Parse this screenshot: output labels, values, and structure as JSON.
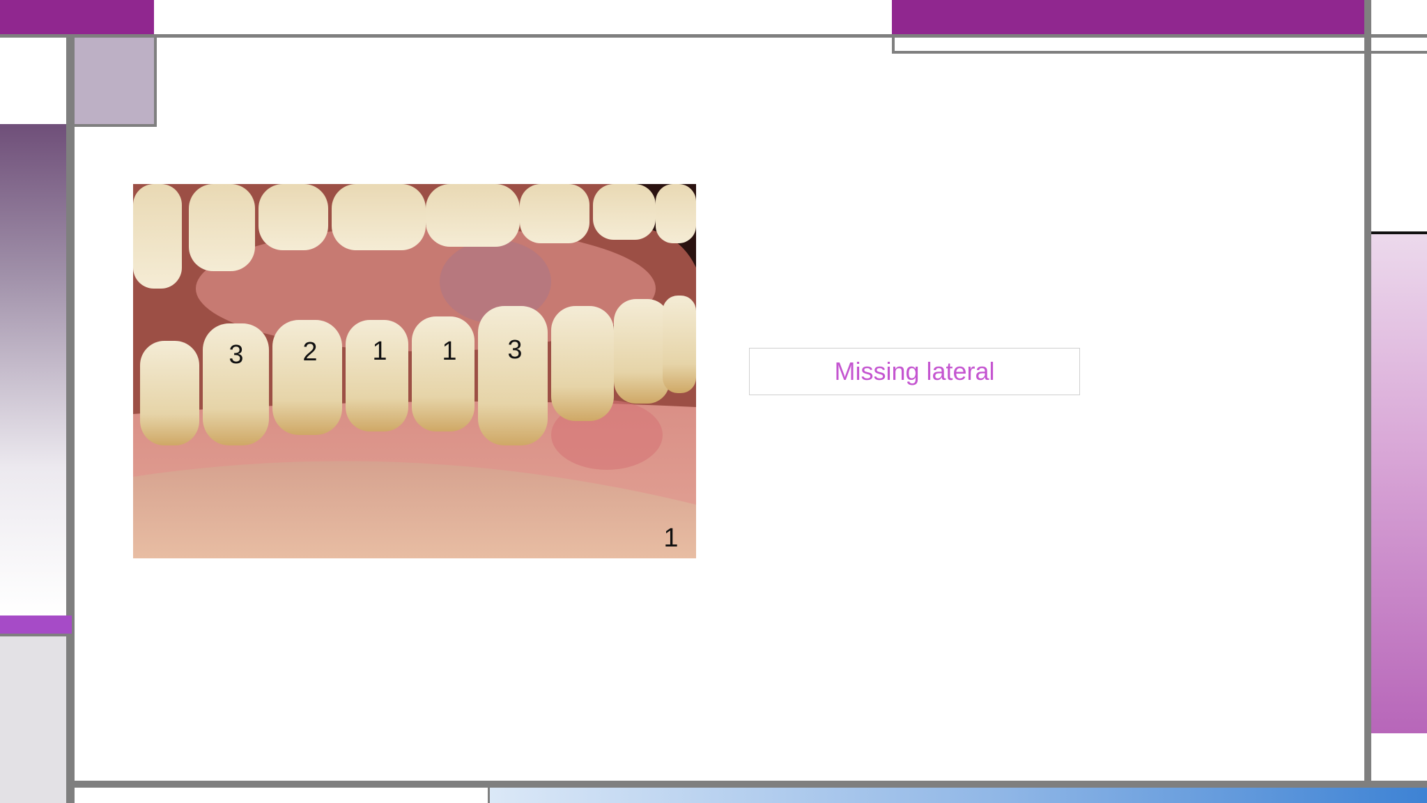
{
  "slide": {
    "caption": "Missing lateral"
  },
  "photo": {
    "tooth_labels": [
      "3",
      "2",
      "1",
      "1",
      "3"
    ],
    "figure_number": "1"
  },
  "colors": {
    "accent_purple": "#90278f",
    "frame_gray": "#7f7f7f",
    "caption_text": "#c455d0"
  }
}
